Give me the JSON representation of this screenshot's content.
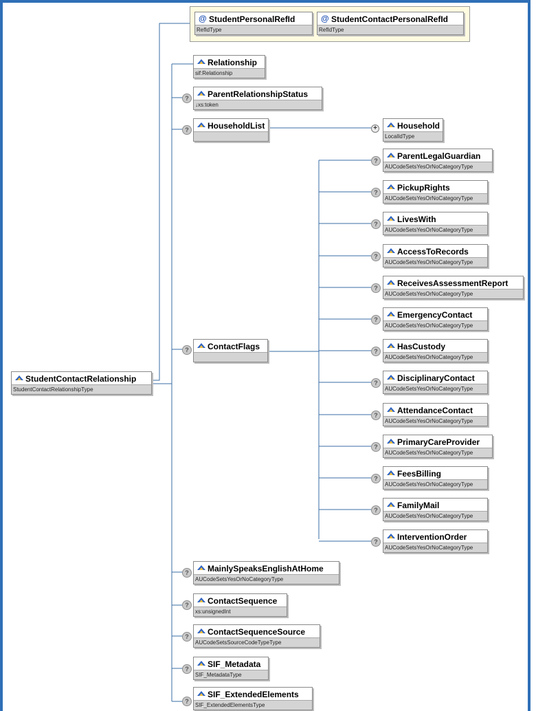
{
  "root": {
    "name": "StudentContactRelationship",
    "type": "StudentContactRelationshipType"
  },
  "attributes": [
    {
      "name": "StudentPersonalRefId",
      "type": "RefIdType"
    },
    {
      "name": "StudentContactPersonalRefId",
      "type": "RefIdType"
    }
  ],
  "elements": {
    "relationship": {
      "name": "Relationship",
      "type": "sif:Relationship"
    },
    "parent_relationship_status": {
      "name": "ParentRelationshipStatus",
      "type": "↓xs:token"
    },
    "household_list": {
      "name": "HouseholdList",
      "type": ""
    },
    "household": {
      "name": "Household",
      "type": "LocalIdType"
    },
    "contact_flags": {
      "name": "ContactFlags",
      "type": ""
    },
    "mainly_speaks_english": {
      "name": "MainlySpeaksEnglishAtHome",
      "type": "AUCodeSetsYesOrNoCategoryType"
    },
    "contact_sequence": {
      "name": "ContactSequence",
      "type": "xs:unsignedInt"
    },
    "contact_sequence_source": {
      "name": "ContactSequenceSource",
      "type": "AUCodeSetsSourceCodeTypeType"
    },
    "sif_metadata": {
      "name": "SIF_Metadata",
      "type": "SIF_MetadataType"
    },
    "sif_extended_elements": {
      "name": "SIF_ExtendedElements",
      "type": "SIF_ExtendedElementsType"
    }
  },
  "flags": [
    {
      "name": "ParentLegalGuardian",
      "type": "AUCodeSetsYesOrNoCategoryType"
    },
    {
      "name": "PickupRights",
      "type": "AUCodeSetsYesOrNoCategoryType"
    },
    {
      "name": "LivesWith",
      "type": "AUCodeSetsYesOrNoCategoryType"
    },
    {
      "name": "AccessToRecords",
      "type": "AUCodeSetsYesOrNoCategoryType"
    },
    {
      "name": "ReceivesAssessmentReport",
      "type": "AUCodeSetsYesOrNoCategoryType"
    },
    {
      "name": "EmergencyContact",
      "type": "AUCodeSetsYesOrNoCategoryType"
    },
    {
      "name": "HasCustody",
      "type": "AUCodeSetsYesOrNoCategoryType"
    },
    {
      "name": "DisciplinaryContact",
      "type": "AUCodeSetsYesOrNoCategoryType"
    },
    {
      "name": "AttendanceContact",
      "type": "AUCodeSetsYesOrNoCategoryType"
    },
    {
      "name": "PrimaryCareProvider",
      "type": "AUCodeSetsYesOrNoCategoryType"
    },
    {
      "name": "FeesBilling",
      "type": "AUCodeSetsYesOrNoCategoryType"
    },
    {
      "name": "FamilyMail",
      "type": "AUCodeSetsYesOrNoCategoryType"
    },
    {
      "name": "InterventionOrder",
      "type": "AUCodeSetsYesOrNoCategoryType"
    }
  ],
  "icons": {
    "optional": "?",
    "expand": "+",
    "attribute": "@"
  }
}
